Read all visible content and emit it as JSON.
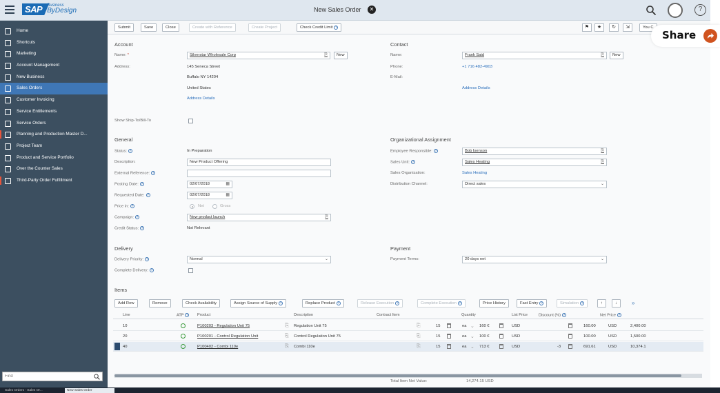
{
  "shell": {
    "logo_main": "SAP",
    "logo_sub_top": "Business",
    "logo_sub_bottom": "ByDesign",
    "title": "New Sales Order",
    "close_glyph": "✕",
    "help_glyph": "?"
  },
  "sidebar": {
    "items": [
      {
        "label": "Home",
        "icon": "home-icon"
      },
      {
        "label": "Shortcuts",
        "icon": "shortcuts-icon"
      },
      {
        "label": "Marketing",
        "icon": "marketing-icon"
      },
      {
        "label": "Account Management",
        "icon": "account-icon"
      },
      {
        "label": "New Business",
        "icon": "business-icon"
      },
      {
        "label": "Sales Orders",
        "icon": "sales-orders-icon"
      },
      {
        "label": "Customer Invoicing",
        "icon": "invoice-icon"
      },
      {
        "label": "Service Entitlements",
        "icon": "entitlement-icon"
      },
      {
        "label": "Service Orders",
        "icon": "service-icon"
      },
      {
        "label": "Planning and Production Master D...",
        "icon": "planning-icon"
      },
      {
        "label": "Project Team",
        "icon": "team-icon"
      },
      {
        "label": "Product and Service Portfolio",
        "icon": "portfolio-icon"
      },
      {
        "label": "Over the Counter Sales",
        "icon": "counter-icon"
      },
      {
        "label": "Third-Party Order Fulfillment",
        "icon": "fulfillment-icon"
      }
    ],
    "active_index": 5,
    "find_placeholder": "Find"
  },
  "toolbar": {
    "submit": "Submit",
    "save": "Save",
    "close": "Close",
    "create_with_reference": "Create with Reference",
    "create_project": "Create Project",
    "check_credit_limit": "Check Credit Limit",
    "you_can": "You C"
  },
  "share": {
    "label": "Share"
  },
  "account": {
    "title": "Account",
    "name_label": "Name:",
    "name_value": "Silverstar Wholesale Corp",
    "new_button": "New",
    "address_label": "Address:",
    "address_lines": [
      "145 Seneca Street",
      "Buffalo NY 14204",
      "United States"
    ],
    "address_details": "Address Details",
    "ship_to_label": "Show Ship-To/Bill-To"
  },
  "contact": {
    "title": "Contact",
    "name_label": "Name:",
    "name_value": "Frank Said",
    "new_button": "New",
    "phone_label": "Phone:",
    "phone_value": "+1 716 482-4903",
    "email_label": "E-Mail:",
    "address_details": "Address Details"
  },
  "general": {
    "title": "General",
    "status_label": "Status:",
    "status_value": "In Preparation",
    "description_label": "Description:",
    "description_value": "New Product Offering",
    "external_ref_label": "External Reference:",
    "posting_date_label": "Posting Date:",
    "posting_date_value": "02/07/2018",
    "requested_date_label": "Requested Date:",
    "requested_date_value": "02/07/2018",
    "price_in_label": "Price in:",
    "price_net": "Net",
    "price_gross": "Gross",
    "campaign_label": "Campaign:",
    "campaign_value": "New product launch",
    "credit_status_label": "Credit Status:",
    "credit_status_value": "Not Relevant"
  },
  "org": {
    "title": "Organizational Assignment",
    "employee_label": "Employee Responsible:",
    "employee_value": "Bob Isenson",
    "sales_unit_label": "Sales Unit:",
    "sales_unit_value": "Sales Heating",
    "sales_org_label": "Sales Organization:",
    "sales_org_value": "Sales Heating",
    "channel_label": "Distribution Channel:",
    "channel_value": "Direct sales"
  },
  "delivery": {
    "title": "Delivery",
    "priority_label": "Delivery Priority:",
    "priority_value": "Normal",
    "complete_label": "Complete Delivery:"
  },
  "payment": {
    "title": "Payment",
    "terms_label": "Payment Terms:",
    "terms_value": "20 days net"
  },
  "items": {
    "title": "Items",
    "buttons": {
      "add_row": "Add Row",
      "remove": "Remove",
      "check_availability": "Check Availability",
      "assign_source": "Assign Source of Supply",
      "replace_product": "Replace Product",
      "release_execution": "Release Execution",
      "complete_execution": "Complete Execution",
      "price_history": "Price History",
      "fast_entry": "Fast Entry",
      "simulation": "Simulation",
      "up": "↑",
      "down": "↓",
      "more": "»"
    },
    "headers": {
      "line": "Line",
      "atp": "ATP",
      "product": "Product",
      "description": "Description",
      "contract_item": "Contract Item",
      "quantity": "Quantity",
      "list_price": "List Price",
      "discount": "Discount (%)",
      "net_price": "Net Price"
    },
    "rows": [
      {
        "line": "10",
        "product": "P100203 - Regulation Unit 75",
        "description": "Regulation Unit 75",
        "qty": "15",
        "unit": "ea",
        "list_price": "160 €",
        "cur": "USD",
        "discount": "",
        "net_price": "160.00",
        "net_cur": "USD",
        "net_value": "2,400.00"
      },
      {
        "line": "20",
        "product": "P100201 - Control Regulation Unit",
        "description": "Control Regulation Unit 75",
        "qty": "15",
        "unit": "ea",
        "list_price": "100 €",
        "cur": "USD",
        "discount": "",
        "net_price": "100.00",
        "net_cur": "USD",
        "net_value": "1,500.00"
      },
      {
        "line": "40",
        "product": "P100402 - Combi 110e",
        "description": "Combi 110e",
        "qty": "15",
        "unit": "ea",
        "list_price": "713 €",
        "cur": "USD",
        "discount": "-3",
        "net_price": "691.61",
        "net_cur": "USD",
        "net_value": "10,374.1"
      }
    ],
    "total_label": "Total Item Net Value:",
    "total_value": "14,274.15 USD"
  },
  "taskbar": {
    "items": [
      "Sales Orders - Sales Or...",
      "New Sales Order"
    ]
  }
}
